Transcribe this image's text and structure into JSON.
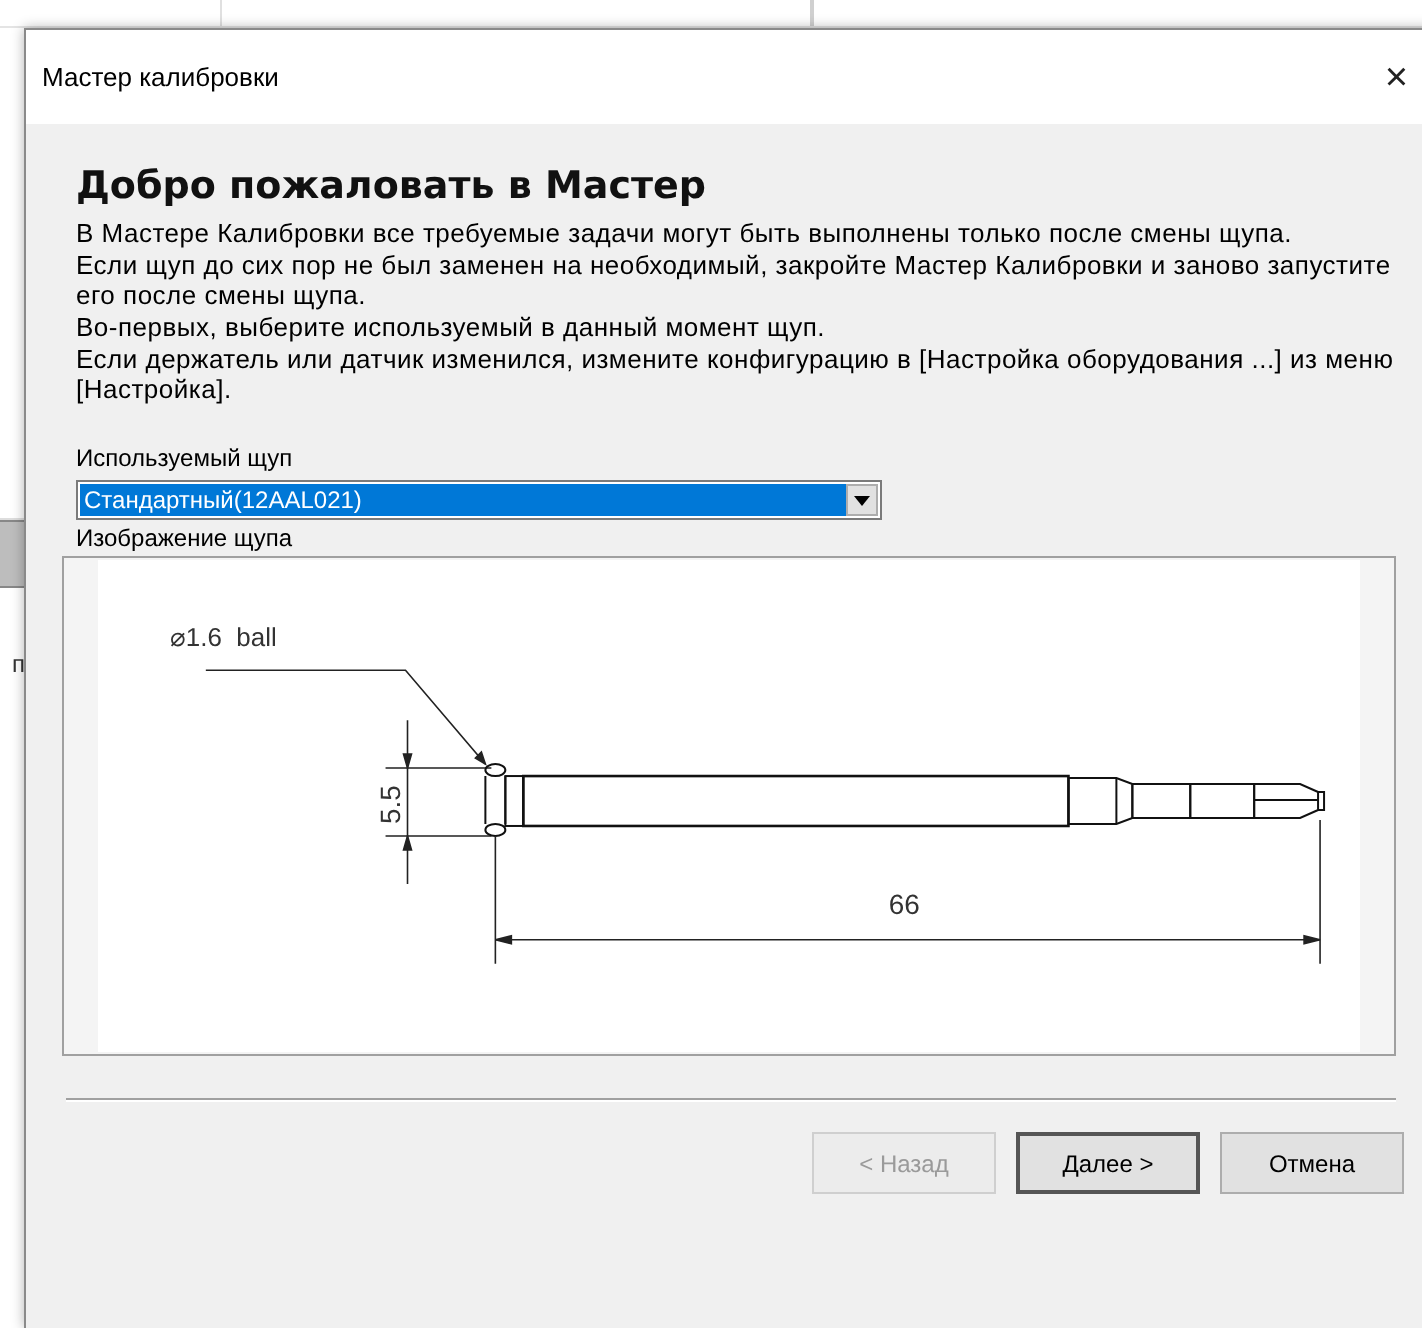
{
  "background_text": "п",
  "window": {
    "title": "Мастер калибровки",
    "close": "×"
  },
  "heading": "Добро пожаловать в Мастер",
  "paragraphs": [
    "В Мастере Калибровки все требуемые задачи могут быть выполнены только после смены щупа.",
    "Если щуп до сих пор не был заменен на необходимый, закройте Мастер Калибровки и заново запустите его после смены щупа.",
    "Во-первых, выберите используемый в данный момент щуп.",
    "Если держатель или датчик изменился, измените конфигурацию в [Настройка оборудования ...] из меню [Настройка]."
  ],
  "probe_select": {
    "label": "Используемый щуп",
    "value": "Стандартный(12AAL021)",
    "selected": true
  },
  "probe_image": {
    "label": "Изображение щупа",
    "ball_label": "⌀1.6  ball",
    "height_dim": "5.5",
    "length_dim": "66"
  },
  "buttons": [
    {
      "label": "< Назад",
      "disabled": true,
      "default": false
    },
    {
      "label": "Далее >",
      "disabled": false,
      "default": true
    },
    {
      "label": "Отмена",
      "disabled": false,
      "default": false
    }
  ]
}
